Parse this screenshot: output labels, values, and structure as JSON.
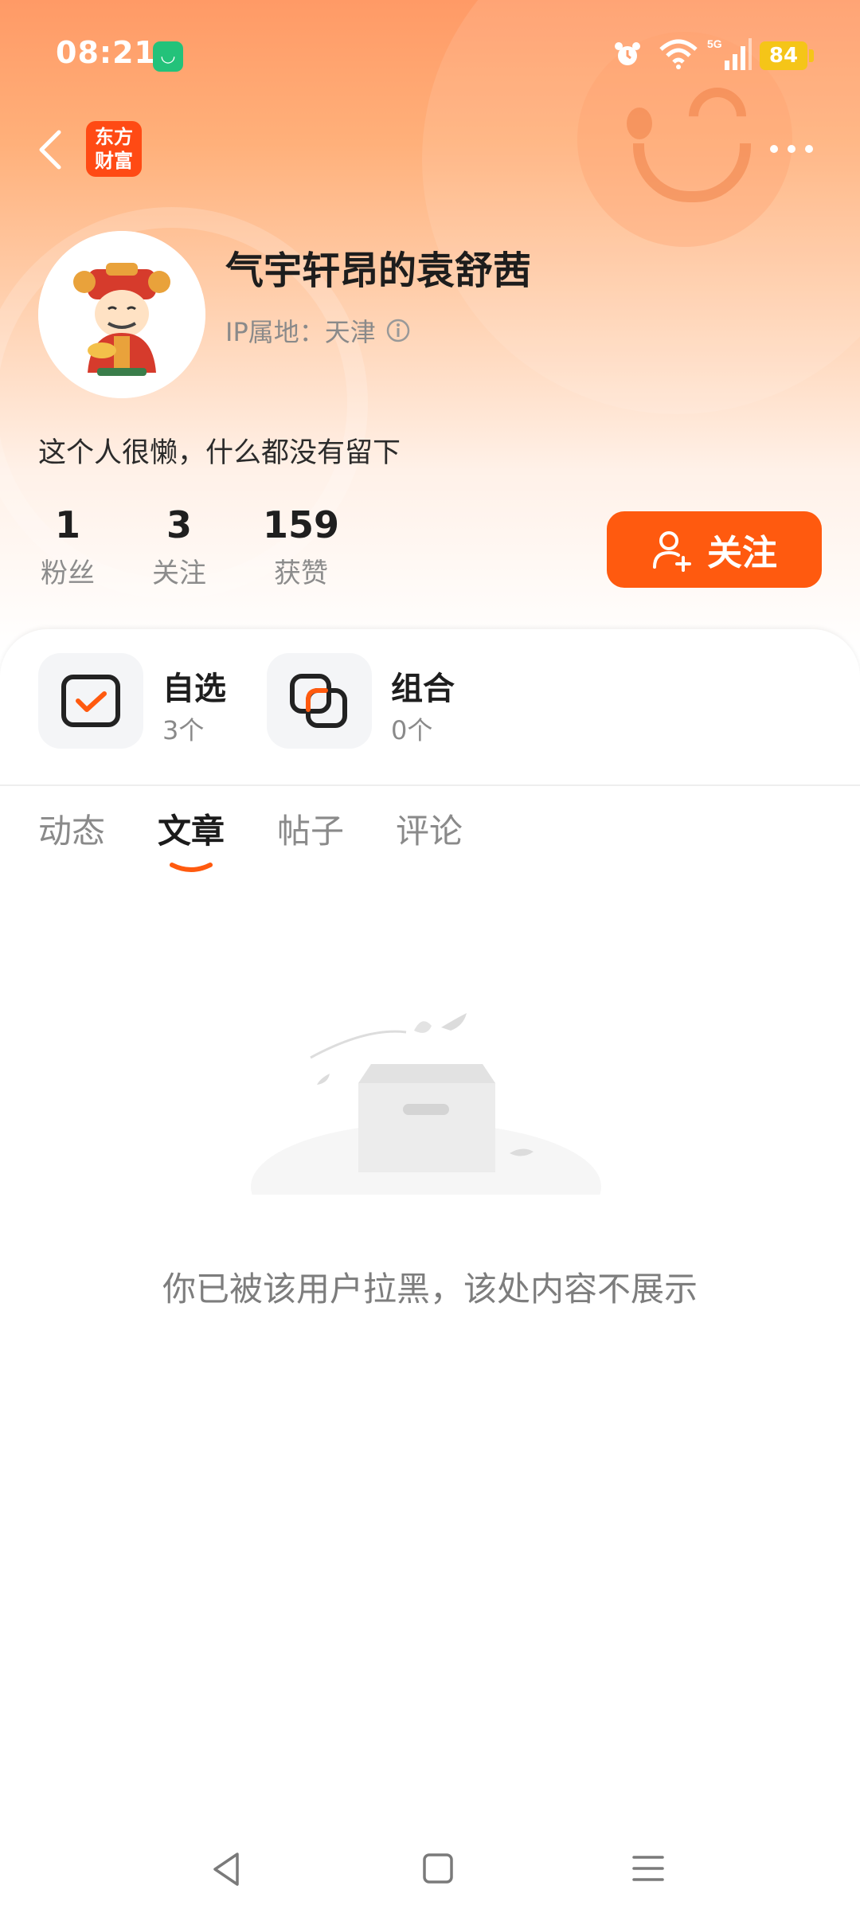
{
  "status_bar": {
    "time": "08:21",
    "battery": "84",
    "network": "5G"
  },
  "header": {
    "app_logo_line1": "东方",
    "app_logo_line2": "财富"
  },
  "profile": {
    "username": "气宇轩昂的袁舒茜",
    "ip_location": "IP属地：天津",
    "bio": "这个人很懒，什么都没有留下",
    "stats": [
      {
        "value": "1",
        "label": "粉丝"
      },
      {
        "value": "3",
        "label": "关注"
      },
      {
        "value": "159",
        "label": "获赞"
      }
    ],
    "follow_button": "关注"
  },
  "quick_items": [
    {
      "title": "自选",
      "count": "3个",
      "icon": "checkbox-icon"
    },
    {
      "title": "组合",
      "count": "0个",
      "icon": "overlap-squares-icon"
    }
  ],
  "tabs": [
    {
      "label": "动态",
      "active": false
    },
    {
      "label": "文章",
      "active": true
    },
    {
      "label": "帖子",
      "active": false
    },
    {
      "label": "评论",
      "active": false
    }
  ],
  "empty_state": {
    "message": "你已被该用户拉黑，该处内容不展示"
  },
  "colors": {
    "accent": "#ff5a0f",
    "header_gradient_top": "#ff9a66",
    "battery": "#f5c518"
  }
}
